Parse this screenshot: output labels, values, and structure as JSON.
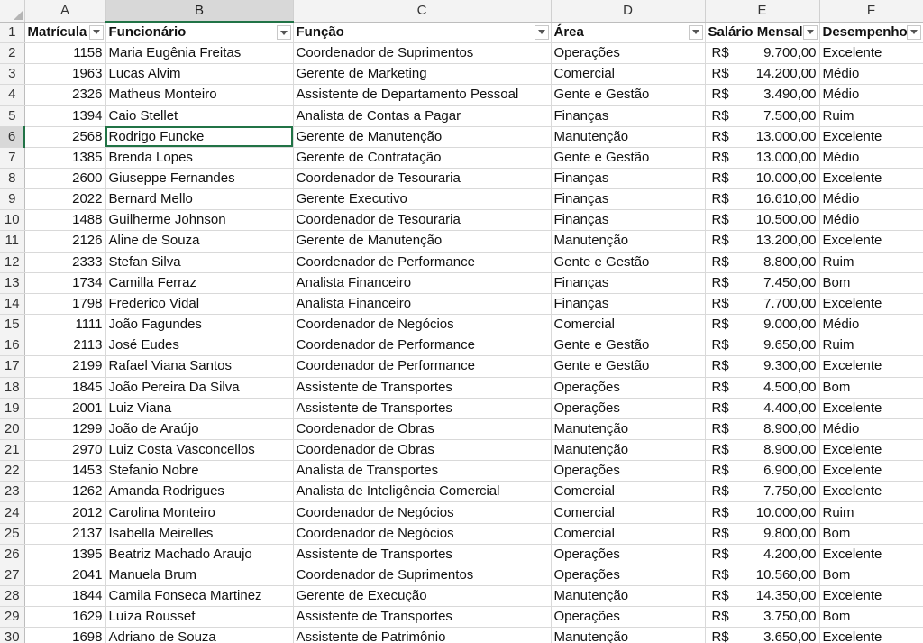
{
  "columns": [
    "A",
    "B",
    "C",
    "D",
    "E",
    "F"
  ],
  "headers": {
    "matricula": "Matrícula",
    "funcionario": "Funcionário",
    "funcao": "Função",
    "area": "Área",
    "salario": "Salário Mensal",
    "desempenho": "Desempenho"
  },
  "currency_symbol": "R$",
  "selection": {
    "column": "B",
    "row": 6
  },
  "accent_color": "#217346",
  "rows": [
    {
      "n": "2",
      "matricula": "1158",
      "funcionario": "Maria Eugênia Freitas",
      "funcao": "Coordenador de Suprimentos",
      "area": "Operações",
      "salario": "9.700,00",
      "desempenho": "Excelente"
    },
    {
      "n": "3",
      "matricula": "1963",
      "funcionario": "Lucas Alvim",
      "funcao": "Gerente de Marketing",
      "area": "Comercial",
      "salario": "14.200,00",
      "desempenho": "Médio"
    },
    {
      "n": "4",
      "matricula": "2326",
      "funcionario": "Matheus Monteiro",
      "funcao": "Assistente de Departamento Pessoal",
      "area": "Gente e Gestão",
      "salario": "3.490,00",
      "desempenho": "Médio"
    },
    {
      "n": "5",
      "matricula": "1394",
      "funcionario": "Caio Stellet",
      "funcao": "Analista de Contas a Pagar",
      "area": "Finanças",
      "salario": "7.500,00",
      "desempenho": "Ruim"
    },
    {
      "n": "6",
      "matricula": "2568",
      "funcionario": "Rodrigo Funcke",
      "funcao": "Gerente de Manutenção",
      "area": "Manutenção",
      "salario": "13.000,00",
      "desempenho": "Excelente"
    },
    {
      "n": "7",
      "matricula": "1385",
      "funcionario": "Brenda Lopes",
      "funcao": "Gerente de Contratação",
      "area": "Gente e Gestão",
      "salario": "13.000,00",
      "desempenho": "Médio"
    },
    {
      "n": "8",
      "matricula": "2600",
      "funcionario": "Giuseppe Fernandes",
      "funcao": "Coordenador de Tesouraria",
      "area": "Finanças",
      "salario": "10.000,00",
      "desempenho": "Excelente"
    },
    {
      "n": "9",
      "matricula": "2022",
      "funcionario": "Bernard Mello",
      "funcao": "Gerente Executivo",
      "area": "Finanças",
      "salario": "16.610,00",
      "desempenho": "Médio"
    },
    {
      "n": "10",
      "matricula": "1488",
      "funcionario": "Guilherme Johnson",
      "funcao": "Coordenador de Tesouraria",
      "area": "Finanças",
      "salario": "10.500,00",
      "desempenho": "Médio"
    },
    {
      "n": "11",
      "matricula": "2126",
      "funcionario": "Aline de Souza",
      "funcao": "Gerente de Manutenção",
      "area": "Manutenção",
      "salario": "13.200,00",
      "desempenho": "Excelente"
    },
    {
      "n": "12",
      "matricula": "2333",
      "funcionario": "Stefan Silva",
      "funcao": "Coordenador de Performance",
      "area": "Gente e Gestão",
      "salario": "8.800,00",
      "desempenho": "Ruim"
    },
    {
      "n": "13",
      "matricula": "1734",
      "funcionario": "Camilla Ferraz",
      "funcao": "Analista Financeiro",
      "area": "Finanças",
      "salario": "7.450,00",
      "desempenho": "Bom"
    },
    {
      "n": "14",
      "matricula": "1798",
      "funcionario": "Frederico Vidal",
      "funcao": "Analista Financeiro",
      "area": "Finanças",
      "salario": "7.700,00",
      "desempenho": "Excelente"
    },
    {
      "n": "15",
      "matricula": "1111",
      "funcionario": "João Fagundes",
      "funcao": "Coordenador de Negócios",
      "area": "Comercial",
      "salario": "9.000,00",
      "desempenho": "Médio"
    },
    {
      "n": "16",
      "matricula": "2113",
      "funcionario": "José Eudes",
      "funcao": "Coordenador de Performance",
      "area": "Gente e Gestão",
      "salario": "9.650,00",
      "desempenho": "Ruim"
    },
    {
      "n": "17",
      "matricula": "2199",
      "funcionario": "Rafael Viana Santos",
      "funcao": "Coordenador de Performance",
      "area": "Gente e Gestão",
      "salario": "9.300,00",
      "desempenho": "Excelente"
    },
    {
      "n": "18",
      "matricula": "1845",
      "funcionario": "João Pereira Da Silva",
      "funcao": "Assistente de Transportes",
      "area": "Operações",
      "salario": "4.500,00",
      "desempenho": "Bom"
    },
    {
      "n": "19",
      "matricula": "2001",
      "funcionario": "Luiz Viana",
      "funcao": "Assistente de Transportes",
      "area": "Operações",
      "salario": "4.400,00",
      "desempenho": "Excelente"
    },
    {
      "n": "20",
      "matricula": "1299",
      "funcionario": "João de Araújo",
      "funcao": "Coordenador de Obras",
      "area": "Manutenção",
      "salario": "8.900,00",
      "desempenho": "Médio"
    },
    {
      "n": "21",
      "matricula": "2970",
      "funcionario": "Luiz Costa Vasconcellos",
      "funcao": "Coordenador de Obras",
      "area": "Manutenção",
      "salario": "8.900,00",
      "desempenho": "Excelente"
    },
    {
      "n": "22",
      "matricula": "1453",
      "funcionario": "Stefanio Nobre",
      "funcao": "Analista de Transportes",
      "area": "Operações",
      "salario": "6.900,00",
      "desempenho": "Excelente"
    },
    {
      "n": "23",
      "matricula": "1262",
      "funcionario": "Amanda Rodrigues",
      "funcao": "Analista de Inteligência Comercial",
      "area": "Comercial",
      "salario": "7.750,00",
      "desempenho": "Excelente"
    },
    {
      "n": "24",
      "matricula": "2012",
      "funcionario": "Carolina Monteiro",
      "funcao": "Coordenador de Negócios",
      "area": "Comercial",
      "salario": "10.000,00",
      "desempenho": "Ruim"
    },
    {
      "n": "25",
      "matricula": "2137",
      "funcionario": "Isabella Meirelles",
      "funcao": "Coordenador de Negócios",
      "area": "Comercial",
      "salario": "9.800,00",
      "desempenho": "Bom"
    },
    {
      "n": "26",
      "matricula": "1395",
      "funcionario": "Beatriz Machado Araujo",
      "funcao": "Assistente de Transportes",
      "area": "Operações",
      "salario": "4.200,00",
      "desempenho": "Excelente"
    },
    {
      "n": "27",
      "matricula": "2041",
      "funcionario": "Manuela Brum",
      "funcao": "Coordenador de Suprimentos",
      "area": "Operações",
      "salario": "10.560,00",
      "desempenho": "Bom"
    },
    {
      "n": "28",
      "matricula": "1844",
      "funcionario": "Camila Fonseca Martinez",
      "funcao": "Gerente de Execução",
      "area": "Manutenção",
      "salario": "14.350,00",
      "desempenho": "Excelente"
    },
    {
      "n": "29",
      "matricula": "1629",
      "funcionario": "Luíza Roussef",
      "funcao": "Assistente de Transportes",
      "area": "Operações",
      "salario": "3.750,00",
      "desempenho": "Bom"
    },
    {
      "n": "30",
      "matricula": "1698",
      "funcionario": "Adriano de Souza",
      "funcao": "Assistente de Patrimônio",
      "area": "Manutenção",
      "salario": "3.650,00",
      "desempenho": "Excelente"
    }
  ]
}
